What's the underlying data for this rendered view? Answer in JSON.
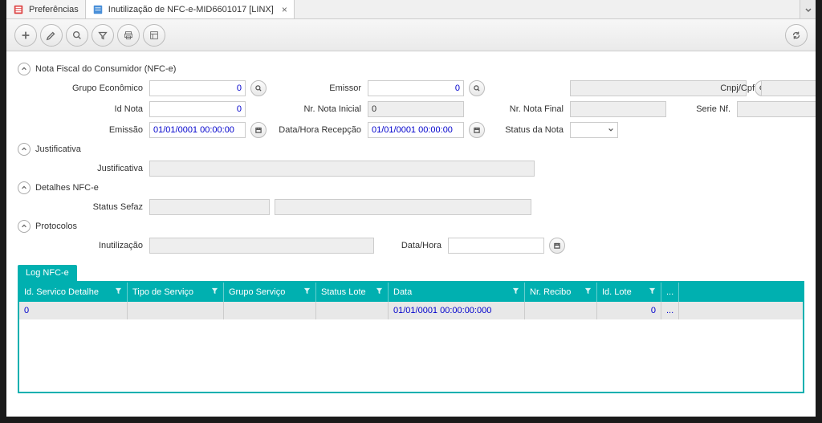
{
  "tabs": {
    "pref": "Preferências",
    "main": "Inutilização de NFC-e-MID6601017 [LINX]"
  },
  "sections": {
    "nfc": "Nota Fiscal do Consumidor (NFC-e)",
    "just": "Justificativa",
    "det": "Detalhes NFC-e",
    "prot": "Protocolos"
  },
  "labels": {
    "grupo": "Grupo Econômico",
    "emissor": "Emissor",
    "cnpj": "Cnpj/Cpf",
    "idnota": "Id Nota",
    "notaini": "Nr. Nota Inicial",
    "notafin": "Nr. Nota Final",
    "serie": "Serie Nf.",
    "emissao": "Emissão",
    "recepcao": "Data/Hora Recepção",
    "status": "Status da Nota",
    "justificativa": "Justificativa",
    "sefaz": "Status Sefaz",
    "inut": "Inutilização",
    "datahora": "Data/Hora"
  },
  "values": {
    "grupo": "0",
    "emissor": "0",
    "idnota": "0",
    "notaini": "0",
    "emissao": "01/01/0001 00:00:00",
    "recepcao": "01/01/0001 00:00:00"
  },
  "logtab": "Log NFC-e",
  "gridcols": {
    "c1": "Id. Servico Detalhe",
    "c2": "Tipo de Serviço",
    "c3": "Grupo Serviço",
    "c4": "Status Lote",
    "c5": "Data",
    "c6": "Nr. Recibo",
    "c7": "Id. Lote",
    "c8": "..."
  },
  "gridrow": {
    "c1": "0",
    "c5": "01/01/0001 00:00:00:000",
    "c7": "0",
    "c8": "..."
  }
}
